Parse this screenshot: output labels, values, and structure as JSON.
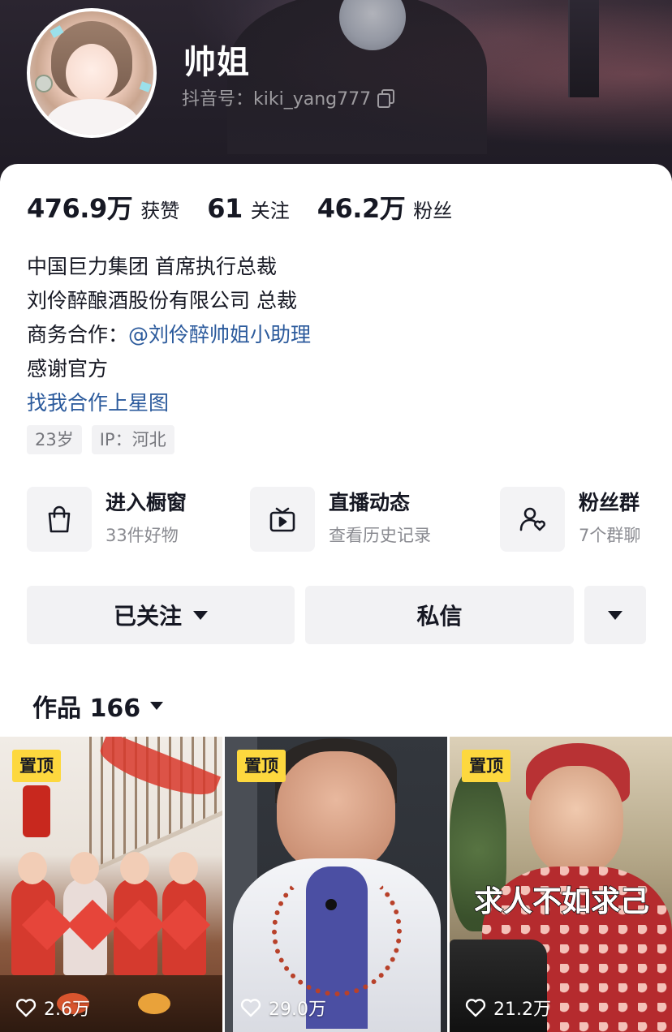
{
  "profile": {
    "nickname": "帅姐",
    "douyin_id": "抖音号：kiki_yang777"
  },
  "stats": [
    {
      "value": "476.9万",
      "label": "获赞"
    },
    {
      "value": "61",
      "label": "关注"
    },
    {
      "value": "46.2万",
      "label": "粉丝"
    }
  ],
  "bio": {
    "line1": "中国巨力集团 首席执行总裁",
    "line2": "刘伶醉酿酒股份有限公司 总裁",
    "line3_prefix": "商务合作：",
    "line3_link": "@刘伶醉帅姐小助理",
    "line4": "感谢官方",
    "star_link": "找我合作上星图"
  },
  "tags": [
    "23岁",
    "IP：河北"
  ],
  "entries": [
    {
      "title": "进入橱窗",
      "sub": "33件好物",
      "icon": "shopping-bag-icon"
    },
    {
      "title": "直播动态",
      "sub": "查看历史记录",
      "icon": "tv-play-icon"
    },
    {
      "title": "粉丝群",
      "sub": "7个群聊",
      "icon": "user-heart-icon"
    }
  ],
  "actions": {
    "follow_label": "已关注",
    "message_label": "私信"
  },
  "works": {
    "label": "作品 166"
  },
  "videos": [
    {
      "pin": "置顶",
      "likes": "2.6万"
    },
    {
      "pin": "置顶",
      "likes": "29.0万"
    },
    {
      "pin": "置顶",
      "likes": "21.2万",
      "overlay": "求人不如求己"
    }
  ]
}
